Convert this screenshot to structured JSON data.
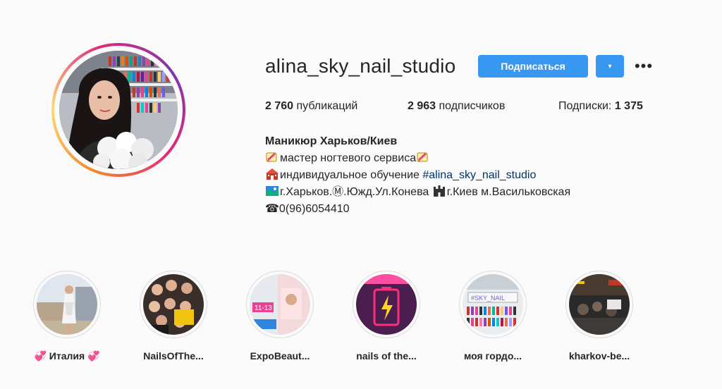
{
  "profile": {
    "username": "alina_sky_nail_studio",
    "follow_label": "Подписаться",
    "dropdown_icon": "▾",
    "more_icon": "•••"
  },
  "stats": {
    "posts_count": "2 760",
    "posts_label": "публикаций",
    "followers_count": "2 963",
    "followers_label": "подписчиков",
    "following_label": "Подписки:",
    "following_count": "1 375"
  },
  "bio": {
    "name": "Маникюр Харьков/Киев",
    "line1": "мастер ногтевого сервиса",
    "line2_text": "индивидуальное обучение ",
    "line2_tag": "#alina_sky_nail_studio",
    "line3": "г.Харьков.Ⓜ.Южд.Ул.Конева ",
    "line3b": "г.Киев м.Васильковская",
    "line4": "☎0(96)6054410"
  },
  "highlights": [
    {
      "label": "💞 Италия 💞",
      "icon": "highlight-italy"
    },
    {
      "label": "NailsOfThe...",
      "icon": "highlight-nailsofthe"
    },
    {
      "label": "ExpoBeaut...",
      "icon": "highlight-expobeauty"
    },
    {
      "label": "nails of the...",
      "icon": "highlight-nailsoftheday"
    },
    {
      "label": "моя гордо...",
      "icon": "highlight-pride"
    },
    {
      "label": "kharkov-be...",
      "icon": "highlight-kharkov"
    }
  ],
  "colors": {
    "accent": "#3897f0",
    "text": "#262626",
    "hashtag": "#003569",
    "background": "#fafafa"
  }
}
